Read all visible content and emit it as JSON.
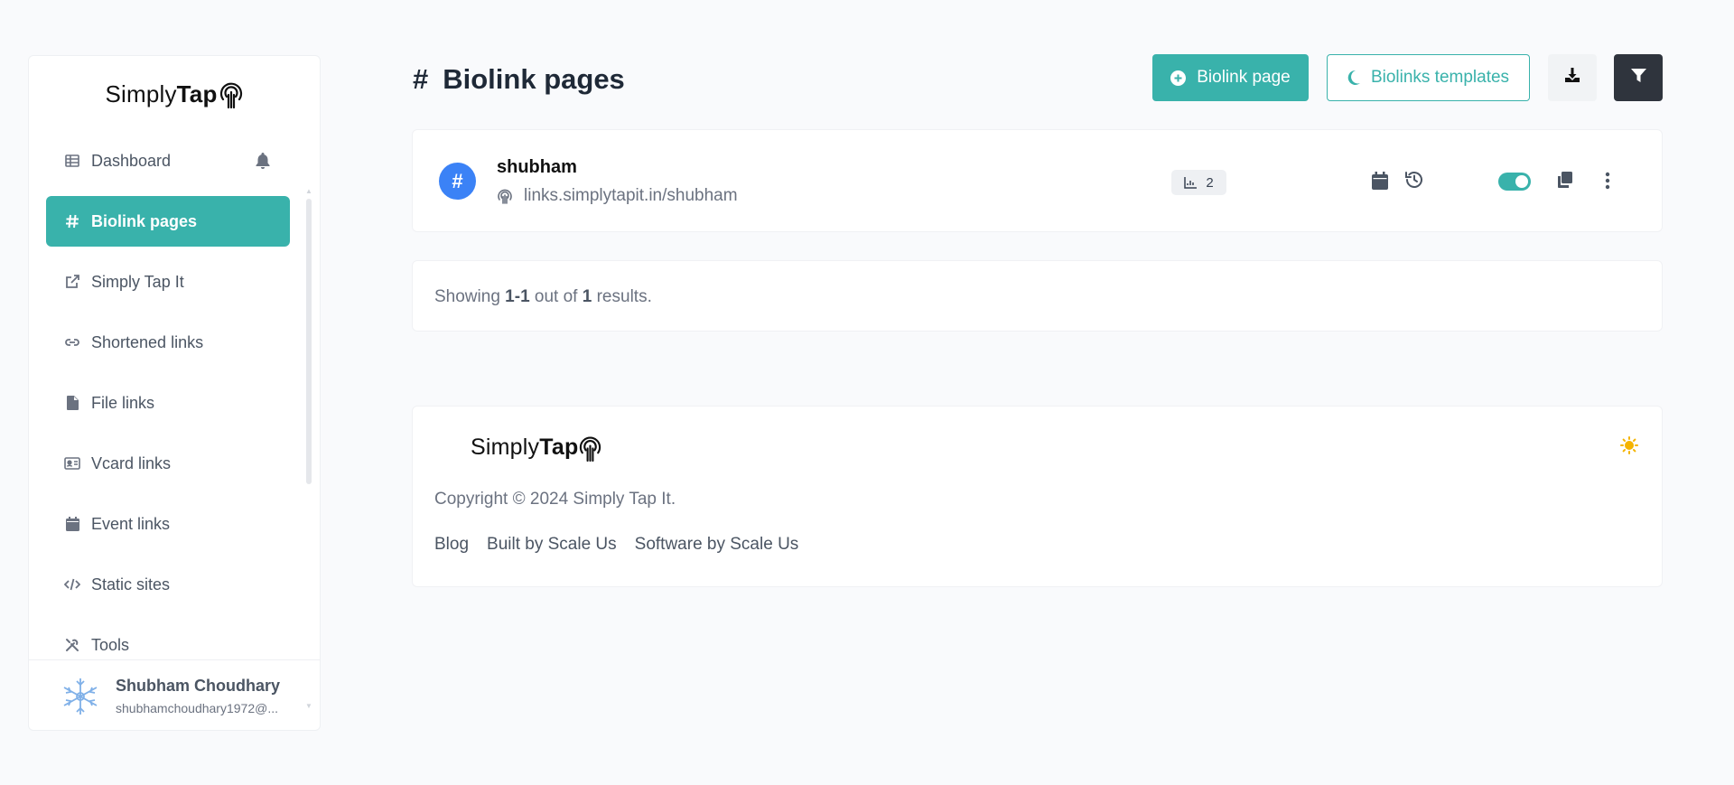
{
  "brand": {
    "name_light": "Simply",
    "name_bold": "Tap"
  },
  "sidebar": {
    "items": [
      {
        "label": "Dashboard",
        "icon": "table-icon"
      },
      {
        "label": "Biolink pages",
        "icon": "hashtag-icon",
        "active": true
      },
      {
        "label": "Simply Tap It",
        "icon": "external-link-icon"
      },
      {
        "label": "Shortened links",
        "icon": "link-icon"
      },
      {
        "label": "File links",
        "icon": "file-icon"
      },
      {
        "label": "Vcard links",
        "icon": "id-card-icon"
      },
      {
        "label": "Event links",
        "icon": "calendar-icon"
      },
      {
        "label": "Static sites",
        "icon": "code-icon"
      },
      {
        "label": "Tools",
        "icon": "tools-icon"
      }
    ],
    "user": {
      "name": "Shubham Choudhary",
      "email": "shubhamchoudhary1972@..."
    }
  },
  "header": {
    "hash": "#",
    "title": "Biolink pages",
    "create_label": "Biolink page",
    "templates_label": "Biolinks templates"
  },
  "links": [
    {
      "name": "shubham",
      "url": "links.simplytapit.in/shubham",
      "stat_count": "2",
      "enabled": true
    }
  ],
  "results": {
    "prefix": "Showing",
    "range": "1-1",
    "middle": "out of",
    "total": "1",
    "suffix": "results."
  },
  "footer": {
    "copyright": "Copyright © 2024 Simply Tap It.",
    "links": [
      "Blog",
      "Built by Scale Us",
      "Software by Scale Us"
    ]
  },
  "colors": {
    "accent": "#39b2ab",
    "link_icon_bg": "#3b82f6",
    "dark_button": "#2f343d",
    "sun": "#f5b400"
  }
}
